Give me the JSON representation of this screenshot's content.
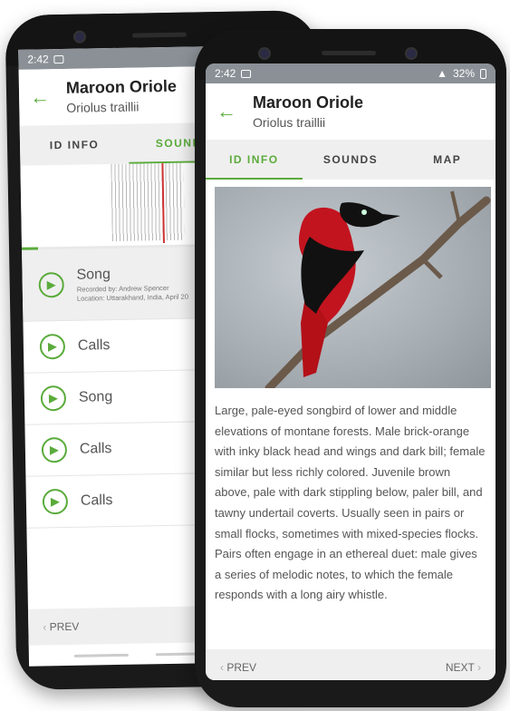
{
  "back_screen": {
    "status_time": "2:42",
    "header": {
      "title": "Maroon Oriole",
      "subtitle": "Oriolus traillii"
    },
    "tabs": [
      "ID INFO",
      "SOUNDS"
    ],
    "sounds": [
      {
        "label": "Song",
        "recorded_by": "Recorded by: Andrew Spencer",
        "location": "Location: Uttarakhand, India, April 20"
      },
      {
        "label": "Calls"
      },
      {
        "label": "Song"
      },
      {
        "label": "Calls"
      },
      {
        "label": "Calls"
      }
    ],
    "footer": {
      "prev": "PREV"
    }
  },
  "front_screen": {
    "status_time": "2:42",
    "status_battery": "32%",
    "header": {
      "title": "Maroon Oriole",
      "subtitle": "Oriolus traillii"
    },
    "tabs": [
      "ID INFO",
      "SOUNDS",
      "MAP"
    ],
    "description": "Large, pale-eyed songbird of lower and middle elevations of montane forests. Male brick-orange with inky black head and wings and dark bill; female similar but less richly colored. Juvenile brown above, pale with dark stippling below, paler bill, and tawny undertail coverts. Usually seen in pairs or small flocks, sometimes with mixed-species flocks. Pairs often engage in an ethereal duet: male gives a series of melodic notes, to which the female responds with a long airy whistle.",
    "footer": {
      "prev": "PREV",
      "next": "NEXT"
    }
  },
  "colors": {
    "accent": "#5aab3b",
    "status_bar": "#8a9096",
    "tab_bg": "#efefef"
  },
  "icons": {
    "back": "arrow-left-icon",
    "play": "play-icon",
    "prev": "chevron-left-icon",
    "next": "chevron-right-icon"
  }
}
